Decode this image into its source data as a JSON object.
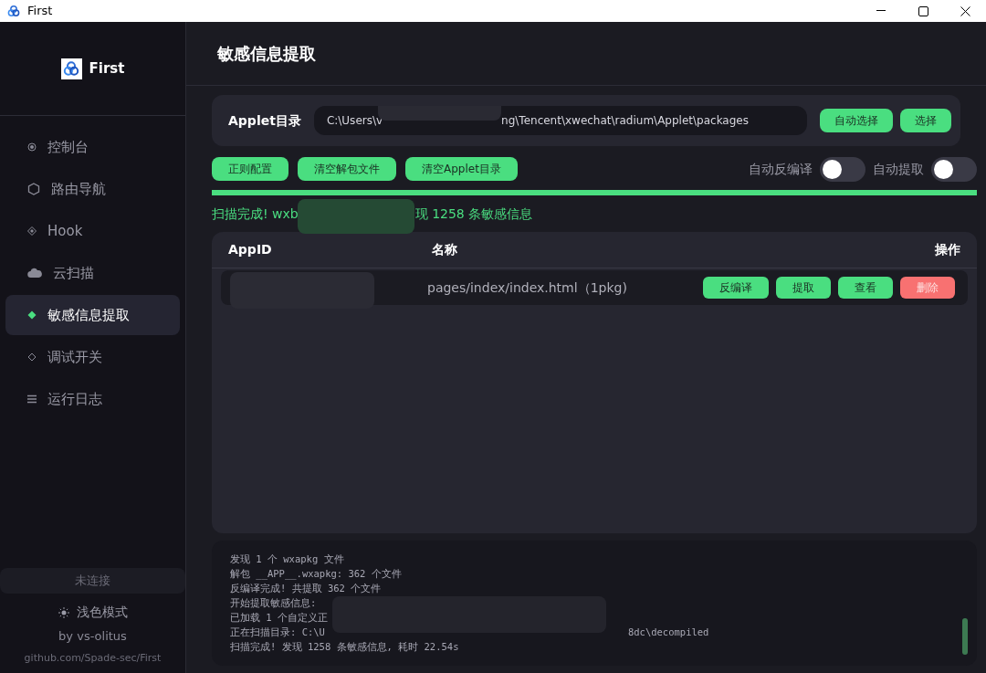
{
  "window": {
    "title": "First"
  },
  "sidebar": {
    "app_name": "First",
    "items": [
      {
        "label": "控制台",
        "selected": false
      },
      {
        "label": "路由导航",
        "selected": false
      },
      {
        "label": "Hook",
        "selected": false
      },
      {
        "label": "云扫描",
        "selected": false
      },
      {
        "label": "敏感信息提取",
        "selected": true
      },
      {
        "label": "调试开关",
        "selected": false
      },
      {
        "label": "运行日志",
        "selected": false
      }
    ],
    "connection": "未连接",
    "theme_toggle": "浅色模式",
    "author": "by vs-olitus",
    "link": "github.com/Spade-sec/First"
  },
  "page_title": "敏感信息提取",
  "applet_dir": {
    "label": "Applet目录",
    "value_start": "C:\\Users\\v",
    "value_end": "ng\\Tencent\\xwechat\\radium\\Applet\\packages",
    "buttons": [
      "自动选择",
      "选择"
    ]
  },
  "actions": [
    "正则配置",
    "清空解包文件",
    "清空Applet目录"
  ],
  "toggles": [
    {
      "label": "自动反编译",
      "on": false
    },
    {
      "label": "自动提取",
      "on": false
    }
  ],
  "progress": {
    "level": 1
  },
  "status": {
    "start": "扫描完成! wxb",
    "end": "现 1258 条敏感信息"
  },
  "table": {
    "columns": [
      "AppID",
      "名称",
      "操作"
    ],
    "rows": [
      {
        "name": "pages/index/index.html（1pkg)",
        "buttons": [
          {
            "label": "反编译",
            "kind": "normal"
          },
          {
            "label": "提取",
            "kind": "normal"
          },
          {
            "label": "查看",
            "kind": "normal"
          },
          {
            "label": "删除",
            "kind": "danger"
          }
        ]
      }
    ]
  },
  "log": [
    {
      "text": "发现 1 个 wxapkg 文件"
    },
    {
      "text": "解包 __APP__.wxapkg: 362 个文件"
    },
    {
      "text": "反编译完成! 共提取 362 个文件"
    },
    {
      "text": "开始提取敏感信息: "
    },
    {
      "text": "已加载 1 个自定义正"
    },
    {
      "text": "正在扫描目录: C:\\U",
      "tail": "8dc\\decompiled"
    },
    {
      "text": "扫描完成! 发现 1258 条敏感信息, 耗时 22.54s"
    }
  ]
}
